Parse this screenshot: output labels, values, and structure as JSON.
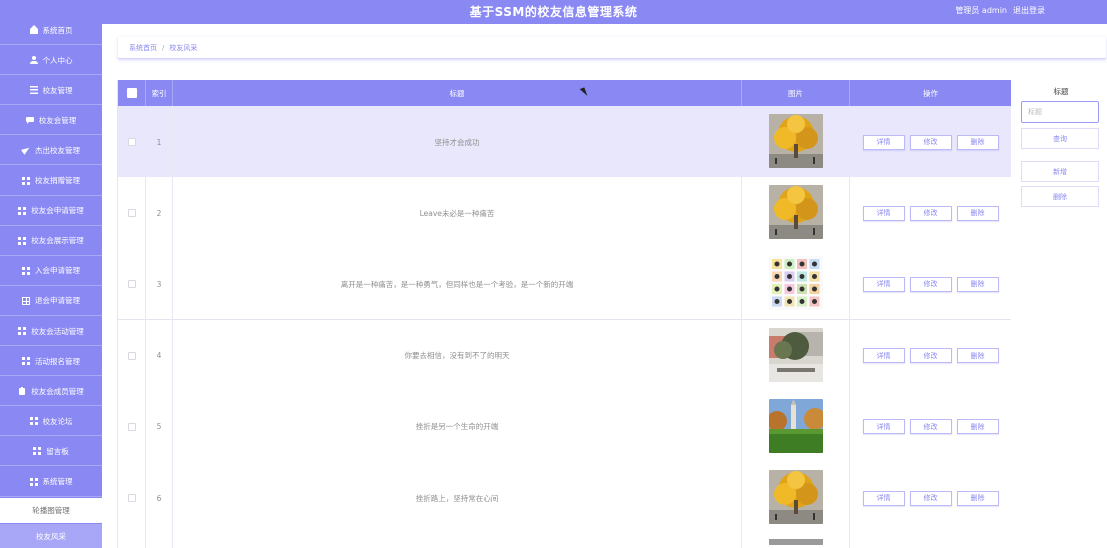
{
  "header": {
    "title": "基于SSM的校友信息管理系统",
    "user_label": "管理员 admin",
    "logout_label": "退出登录",
    "color": "#8a88f3"
  },
  "sidebar": {
    "items": [
      {
        "label": "系统首页",
        "icon": "home-icon"
      },
      {
        "label": "个人中心",
        "icon": "user-icon"
      },
      {
        "label": "校友管理",
        "icon": "list-icon"
      },
      {
        "label": "校友会管理",
        "icon": "chat-icon"
      },
      {
        "label": "杰出校友管理",
        "icon": "send-icon"
      },
      {
        "label": "校友捐赠管理",
        "icon": "grid-icon"
      },
      {
        "label": "校友会申请管理",
        "icon": "grid-icon"
      },
      {
        "label": "校友会展示管理",
        "icon": "grid-icon"
      },
      {
        "label": "入会申请管理",
        "icon": "grid-icon"
      },
      {
        "label": "退会申请管理",
        "icon": "table-icon"
      },
      {
        "label": "校友会活动管理",
        "icon": "grid-icon"
      },
      {
        "label": "活动报名管理",
        "icon": "grid-icon"
      },
      {
        "label": "校友会成员管理",
        "icon": "clipboard-icon"
      },
      {
        "label": "校友论坛",
        "icon": "grid-icon"
      },
      {
        "label": "留言板",
        "icon": "grid-icon"
      },
      {
        "label": "系统管理",
        "icon": "grid-icon"
      }
    ],
    "sub_items": [
      {
        "label": "轮播图管理",
        "active": false
      },
      {
        "label": "校友风采",
        "active": true
      }
    ]
  },
  "breadcrumb": {
    "home": "系统首页",
    "separator": "/",
    "current": "校友风采"
  },
  "table": {
    "columns": {
      "index": "索引",
      "title": "标题",
      "image": "图片",
      "actions": "操作"
    },
    "rows": [
      {
        "index": "1",
        "title": "坚持才会成功",
        "image": "ginkgo-tree"
      },
      {
        "index": "2",
        "title": "Leave未必是一种痛苦",
        "image": "ginkgo-tree"
      },
      {
        "index": "3",
        "title": "离开是一种痛苦，是一种勇气，但同样也是一个考验，是一个新的开端",
        "image": "icon-collage"
      },
      {
        "index": "4",
        "title": "你要去相信，没有到不了的明天",
        "image": "campus-plaza"
      },
      {
        "index": "5",
        "title": "挫折是另一个生命的开端",
        "image": "campus-lawn"
      },
      {
        "index": "6",
        "title": "挫折路上，坚持常在心间",
        "image": "ginkgo-tree"
      }
    ],
    "actions": {
      "detail": "详情",
      "edit": "修改",
      "delete": "删除"
    }
  },
  "search_panel": {
    "title": "标题",
    "input_placeholder": "标题",
    "search_label": "查询",
    "add_label": "新增",
    "delete_label": "删除"
  }
}
